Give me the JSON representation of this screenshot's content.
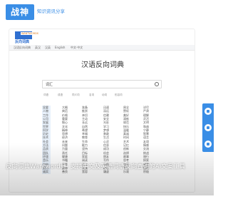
{
  "header": {
    "logo_text": "战神",
    "site_name": "知识资讯分享"
  },
  "app": {
    "logo_tag": "WANTWORDS",
    "logo_text": "反向词典",
    "nav_tabs": [
      "汉语反向词典",
      "英汉",
      "汉英",
      "English",
      "中文·中文"
    ],
    "title": "汉语反向词典",
    "search_value": "词汇",
    "filters": [
      "词语",
      "成语",
      "同义词",
      "名词",
      "动词",
      "形容词"
    ],
    "results": [
      [
        "显要",
        "大概",
        "准备",
        "迅速",
        "周全",
        "详尽"
      ],
      [
        "人物",
        "典范",
        "推崇",
        "深远",
        "赞叹",
        "严肃"
      ],
      [
        "工作",
        "价格",
        "亲切",
        "信赖",
        "美好",
        "理解"
      ],
      [
        "公司",
        "重要",
        "主动",
        "安全",
        "清新",
        "灵活"
      ],
      [
        "发展",
        "细心",
        "长远",
        "光彩",
        "规范",
        "文明"
      ],
      [
        "世界",
        "文化",
        "自然",
        "学习",
        "快乐",
        "和谐"
      ],
      [
        "科学",
        "精神",
        "希望",
        "梦想",
        "温暖",
        "宁静"
      ],
      [
        "历史",
        "思想",
        "幸福",
        "勇敢",
        "真诚",
        "智慧"
      ],
      [
        "技术",
        "经济",
        "教育",
        "生活",
        "时间",
        "语言"
      ],
      [
        "社会",
        "未来",
        "生命",
        "心灵",
        "艺术",
        "友谊"
      ],
      [
        "方法",
        "问题",
        "能力",
        "信息",
        "记忆",
        "情感"
      ],
      [
        "品质",
        "力量",
        "坚持",
        "成功",
        "创新",
        "交流"
      ],
      [
        "团队",
        "责任",
        "目标",
        "机会",
        "选择",
        "挑战"
      ],
      [
        "环境",
        "健康",
        "家庭",
        "朋友",
        "故事",
        "旅行"
      ],
      [
        "音乐",
        "书籍",
        "阅读",
        "写作",
        "思考",
        "探索"
      ],
      [
        "自由",
        "平等",
        "正义",
        "尊重",
        "包容",
        "感恩"
      ],
      [
        "努力",
        "勤奋",
        "认真",
        "耐心",
        "专注",
        "细致"
      ],
      [
        "诚实",
        "善良",
        "宽容",
        "谦虚",
        "乐观",
        "积极"
      ]
    ]
  },
  "caption": "反向词典Wantwords – 支持中文及英语词语反向查询的AI文案工具"
}
